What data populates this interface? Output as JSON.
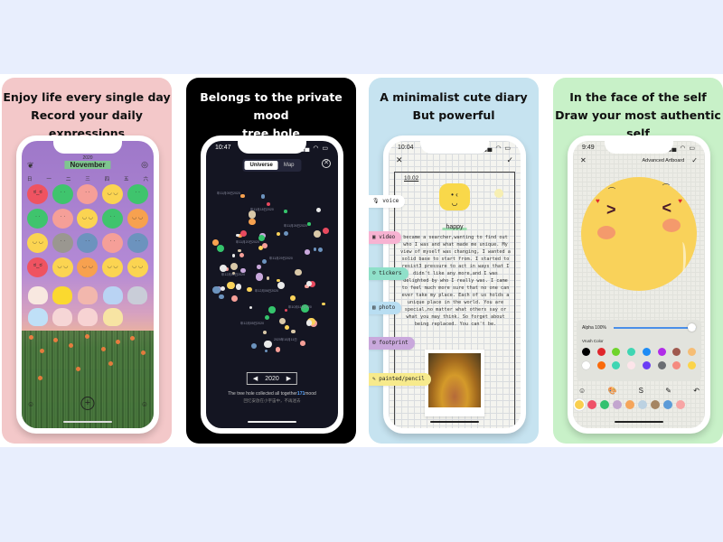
{
  "colors": {
    "page_bg": "#e8eefd",
    "card1_bg": "#f3c8c9",
    "card2_bg": "#000000",
    "card3_bg": "#c6e3f0",
    "card4_bg": "#c8f1c8",
    "accent_blue": "#5aa6ff"
  },
  "card1": {
    "headline_line1": "Enjoy life every single day",
    "headline_line2": "Record your daily expressions",
    "screen": {
      "year": "2020",
      "month": "November",
      "left_icon": "leaf-icon",
      "right_icon": "instagram-icon",
      "weekdays": [
        "日",
        "一",
        "二",
        "三",
        "四",
        "五",
        "六"
      ],
      "moods": [
        {
          "color": "#ef5361",
          "face": "ಠ_ಠ"
        },
        {
          "color": "#3fc46d",
          "face": "· ·"
        },
        {
          "color": "#f59f98",
          "face": "· ·"
        },
        {
          "color": "#fbd451",
          "face": "◡ ◡"
        },
        {
          "color": "#3fc46d",
          "face": "· ·"
        },
        {
          "color": "#3fc46d",
          "face": "· ·"
        },
        {
          "color": "#f59f98",
          "face": "· ·"
        },
        {
          "color": "#fbd451",
          "face": "◡ ◡"
        },
        {
          "color": "#3fc46d",
          "face": "· ·"
        },
        {
          "color": "#f7a14f",
          "face": "◡ ◡"
        },
        {
          "color": "#fbd451",
          "face": "◡ ◡"
        },
        {
          "color": "#9a9790",
          "face": "· ·"
        },
        {
          "color": "#6c93be",
          "face": "· ·"
        },
        {
          "color": "#f59f98",
          "face": "· ·"
        },
        {
          "color": "#6c93be",
          "face": "· ·"
        },
        {
          "color": "#ef5361",
          "face": "ಠ_ಠ"
        },
        {
          "color": "#fbd451",
          "face": "◡ ◡"
        },
        {
          "color": "#f7a14f",
          "face": "◡ ◡"
        },
        {
          "color": "#fbd451",
          "face": "◡ ◡"
        },
        {
          "color": "#fbd451",
          "face": "◡ ◡"
        }
      ],
      "bunnies": [
        "#f8e8e0",
        "#fbd92f",
        "#f2b7ad",
        "#b9d3f3",
        "#c9cdd8",
        "#bfe0f7",
        "#f6d6d6",
        "#f7d3d3",
        "#f7e4a3"
      ],
      "bottom_left_icon": "smiley-outline-icon",
      "add_icon": "plus-circle-icon",
      "bottom_right_icon": "smiley-outline-icon"
    }
  },
  "card2": {
    "headline_line1": "Belongs to the private mood",
    "headline_line2": "tree hole",
    "screen": {
      "time": "10:47",
      "tabs": [
        "Universe",
        "Map"
      ],
      "active_tab": "Universe",
      "close_icon": "close-circle-icon",
      "dot_labels": [
        "年11月05日2020",
        "年11月18日2020",
        "年11月26日2020",
        "年11月20日2020",
        "年11月29日2020",
        "年12月01日2020",
        "年12月06日2020",
        "年10月11日2020",
        "年12月05日2020",
        "2020年10月11日"
      ],
      "year": "2020",
      "prev_label": "◀",
      "next_label": "▶",
      "collected_prefix": "The tree hole collected all together",
      "collected_count": "171",
      "collected_suffix": "mood",
      "collected_sub": "回忆安放在小宇宙中，不再迷去"
    }
  },
  "card3": {
    "headline_line1": "A minimalist cute diary",
    "headline_line2": "But powerful",
    "screen": {
      "time": "10:04",
      "close_icon": "x-icon",
      "confirm_icon": "check-icon",
      "date": "10.02",
      "mood_label": "happy",
      "body": "became a searcher,wanting to find out who I was and what made me unique. My view of myself was changing, I wanted a solid base to start from. I started to resist3 pressure to act in ways that I didn't like any more,and I was delighted by who I really was. I came to feel much more sure that no one can ever take my place. Each of us holds a unique place in the world. You are special,no matter what others say or what you may think. So forget about being replaced. You can't be.",
      "tags": [
        {
          "label": "voice",
          "icon": "microphone-icon",
          "color": "#ffffff"
        },
        {
          "label": "video",
          "icon": "video-icon",
          "color": "#f7b3d2"
        },
        {
          "label": "tickers",
          "icon": "sticker-icon",
          "color": "#8fe0c9"
        },
        {
          "label": "photo",
          "icon": "photo-icon",
          "color": "#b9def2"
        },
        {
          "label": "footprint",
          "icon": "footprint-icon",
          "color": "#c9a8dc"
        },
        {
          "label": "painted/pencil",
          "icon": "pencil-icon",
          "color": "#f7ea8c"
        }
      ]
    }
  },
  "card4": {
    "headline_line1": "In the face of the self",
    "headline_line2": "Draw your most authentic",
    "headline_line3": "self",
    "screen": {
      "time": "9:49",
      "close_icon": "x-icon",
      "title": "Advanced Artboard",
      "confirm_icon": "check-icon",
      "alpha_label": "Alpha 100%",
      "alpha_value": 1.0,
      "brush_color_label": "Vrush Color",
      "palette_row1": [
        "#000000",
        "#e0262b",
        "#6fd42b",
        "#3fd6b3",
        "#1e8cf5",
        "#b12de8",
        "#a0594e",
        "#f6bd74"
      ],
      "palette_row2": [
        "#ffffff",
        "#fa6a0a",
        "#3fd6b3",
        "#fde5ea",
        "#6a3df5",
        "#6b6e73",
        "#f58a80",
        "#fbd44a"
      ],
      "tools": [
        "smiley-icon",
        "palette-icon",
        "brush-stroke-icon",
        "pencil-icon",
        "undo-icon"
      ],
      "bottom_colors": [
        "#f9cf4f",
        "#ef5168",
        "#33c16f",
        "#c3a6cf",
        "#f5a55a",
        "#bcd2e2",
        "#a58563",
        "#5b9bd8",
        "#f7a5a5"
      ]
    }
  }
}
